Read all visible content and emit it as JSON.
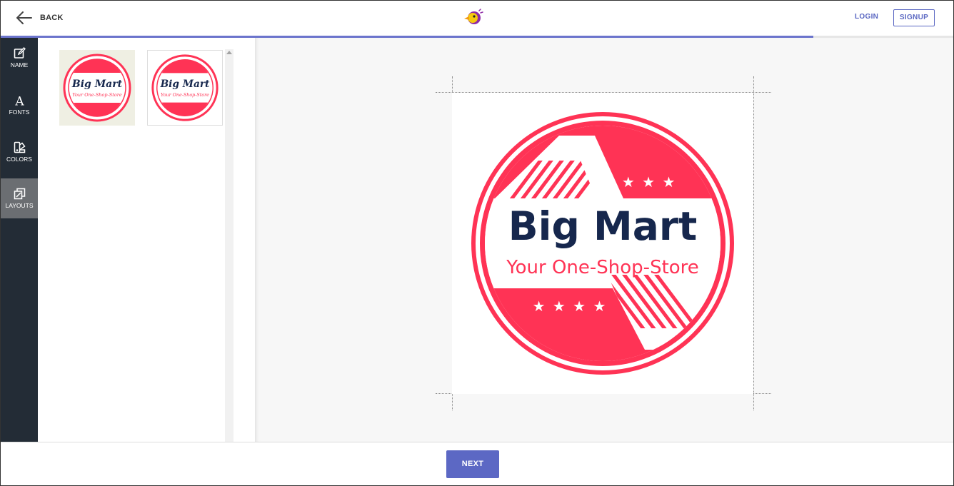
{
  "header": {
    "back_label": "BACK",
    "login_label": "LOGIN",
    "signup_label": "SIGNUP",
    "brand_icon": "parrot-logo-icon",
    "accent_color": "#5a67c2"
  },
  "progress": {
    "percent": 85.3
  },
  "sidebar": {
    "items": [
      {
        "label": "NAME",
        "icon": "edit-icon",
        "active": false
      },
      {
        "label": "FONTS",
        "icon": "font-icon",
        "active": false
      },
      {
        "label": "COLORS",
        "icon": "palette-icon",
        "active": false
      },
      {
        "label": "LAYOUTS",
        "icon": "layouts-icon",
        "active": true
      }
    ]
  },
  "layouts": {
    "thumbnails": [
      {
        "title": "Big Mart",
        "tagline": "Your One-Shop-Store",
        "background": "#efefe3"
      },
      {
        "title": "Big Mart",
        "tagline": "Your One-Shop-Store",
        "background": "#ffffff"
      }
    ]
  },
  "logo": {
    "title": "Big Mart",
    "tagline": "Your One-Shop-Store",
    "stars": "★ ★ ★ ★",
    "primary_color": "#ff3355",
    "text_color": "#16274d"
  },
  "footer": {
    "next_label": "NEXT"
  }
}
